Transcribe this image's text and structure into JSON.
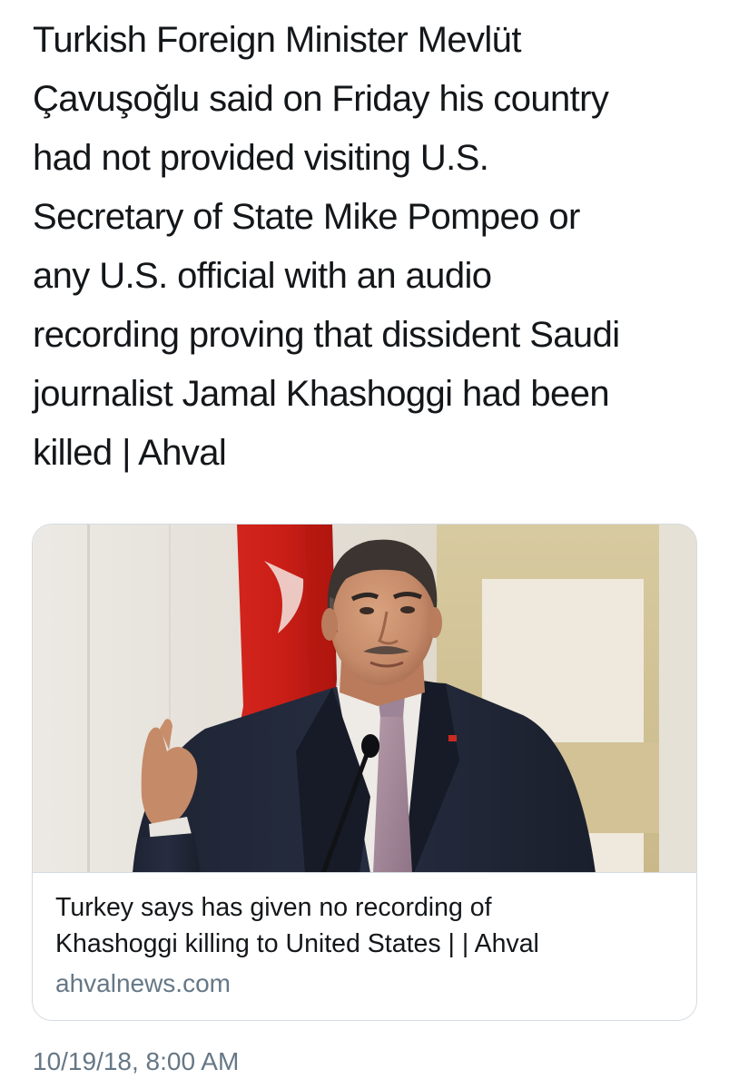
{
  "tweet": {
    "text": "Turkish Foreign Minister Mevlüt\nÇavuşoğlu said on Friday his country\nhad not provided visiting U.S.\nSecretary of State Mike Pompeo or\nany U.S. official with an audio\nrecording proving that dissident Saudi\njournalist Jamal Khashoggi had been\nkilled | Ahval",
    "timestamp": "10/19/18, 8:00 AM"
  },
  "link_card": {
    "title": "Turkey says has given no recording of\nKhashoggi killing to United States | | Ahval",
    "domain": "ahvalnews.com"
  }
}
